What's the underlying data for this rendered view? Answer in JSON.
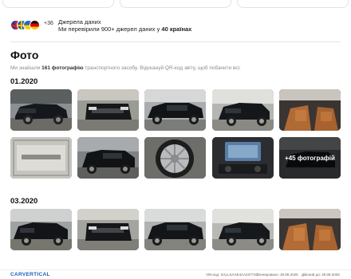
{
  "sources": {
    "flag_count": "+36",
    "title": "Джерела даних",
    "subtitle_prefix": "Ми перевірили 900+ джерел даних у",
    "subtitle_bold": "40 країнах"
  },
  "photos": {
    "title": "Фото",
    "note_prefix": "Ми знайшли",
    "note_bold": "161 фотографію",
    "note_suffix": "транспортного засобу. Відскануй QR-код звіту, щоб побачити всі.",
    "groups": [
      {
        "date": "01.2020"
      },
      {
        "date": "03.2020"
      }
    ],
    "more_label": "+45 фотографій"
  },
  "footer": {
    "logo": "CARVERTICAL",
    "vin": "VIN-код: SALLSAAE4AA237740",
    "generated": "Згенеровано: 30.09.2025",
    "valid": "Дійсний до: 29.09.2026"
  },
  "colors": {
    "accent": "#1a5fb4",
    "muted_text": "#8a8a8a"
  }
}
